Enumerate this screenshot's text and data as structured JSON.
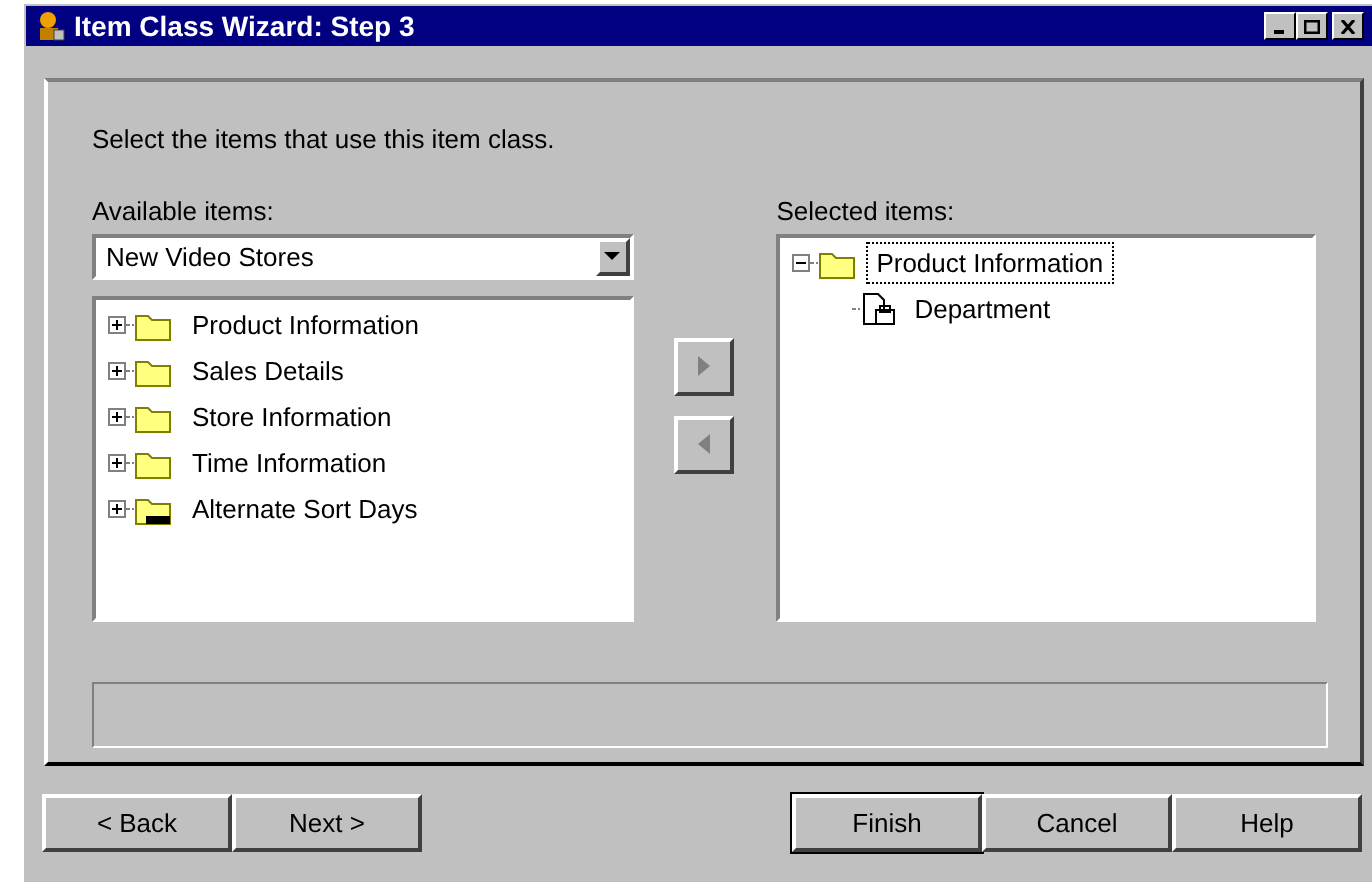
{
  "window": {
    "title": "Item Class Wizard: Step 3"
  },
  "instruction": "Select the items that use this item class.",
  "available": {
    "label": "Available items:",
    "dropdown": {
      "value": "New Video Stores"
    },
    "items": [
      {
        "label": "Product Information",
        "kind": "folder",
        "expanded": false,
        "selected": false
      },
      {
        "label": "Sales Details",
        "kind": "folder",
        "expanded": false,
        "selected": false
      },
      {
        "label": "Store Information",
        "kind": "folder",
        "expanded": false,
        "selected": false
      },
      {
        "label": "Time Information",
        "kind": "folder",
        "expanded": false,
        "selected": false
      },
      {
        "label": "Alternate Sort Days",
        "kind": "sql",
        "expanded": false,
        "selected": false
      }
    ]
  },
  "move_buttons": [
    {
      "kind": "add",
      "disabled": true
    },
    {
      "kind": "remove",
      "disabled": true
    }
  ],
  "selected_items": {
    "label": "Selected items:",
    "items": [
      {
        "label": "Product Information",
        "kind": "folder",
        "expanded": true,
        "selected": true,
        "children": [
          {
            "label": "Department",
            "kind": "item",
            "selected": false
          }
        ]
      }
    ]
  },
  "buttons": [
    {
      "label": "< Back",
      "default": false
    },
    {
      "label": "Next >",
      "default": false
    },
    {
      "label": "Finish",
      "default": true
    },
    {
      "label": "Cancel",
      "default": false
    },
    {
      "label": "Help",
      "default": false
    }
  ]
}
